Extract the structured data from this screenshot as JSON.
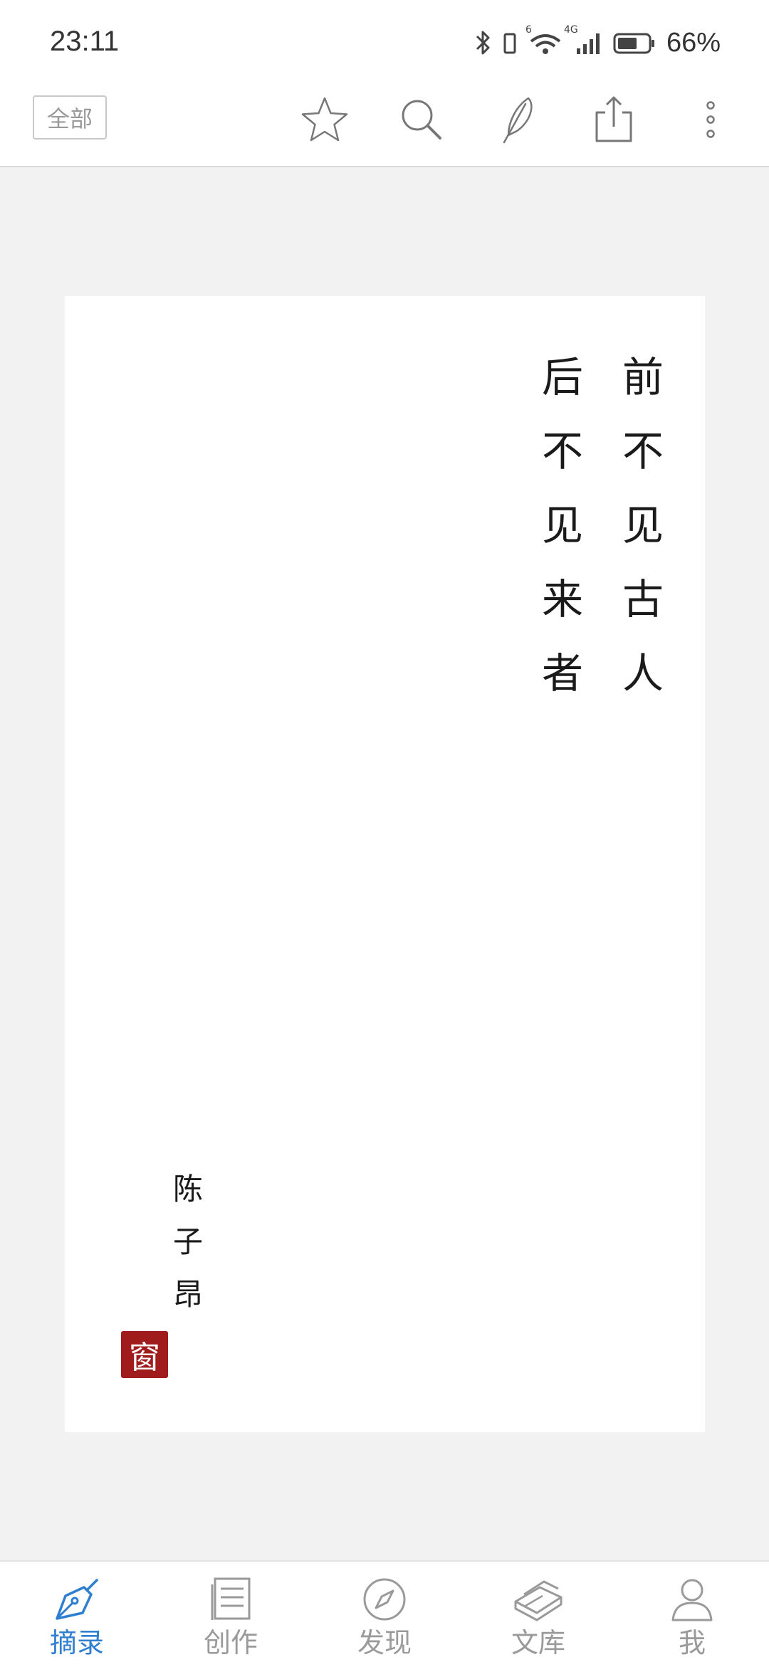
{
  "status_bar": {
    "time": "23:11",
    "battery_percent": "66%",
    "network_badge_1": "6",
    "network_badge_2": "4G",
    "battery_level": 0.66
  },
  "toolbar": {
    "filter_label": "全部",
    "icons": [
      "star-icon",
      "search-icon",
      "feather-pen-icon",
      "share-icon",
      "more-vertical-icon"
    ]
  },
  "card": {
    "lines": [
      {
        "chars": [
          "前",
          "不",
          "见",
          "古",
          "人"
        ]
      },
      {
        "chars": [
          "后",
          "不",
          "见",
          "来",
          "者"
        ]
      }
    ],
    "author": [
      "陈",
      "子",
      "昂"
    ],
    "seal": "窗"
  },
  "bottom_nav": {
    "items": [
      {
        "label": "摘录",
        "icon": "pen-nib-icon",
        "active": true
      },
      {
        "label": "创作",
        "icon": "document-icon",
        "active": false
      },
      {
        "label": "发现",
        "icon": "compass-icon",
        "active": false
      },
      {
        "label": "文库",
        "icon": "books-icon",
        "active": false
      },
      {
        "label": "我",
        "icon": "person-icon",
        "active": false
      }
    ]
  },
  "colors": {
    "accent": "#2f7fd0",
    "seal": "#a01b1b",
    "background": "#f2f2f2"
  }
}
